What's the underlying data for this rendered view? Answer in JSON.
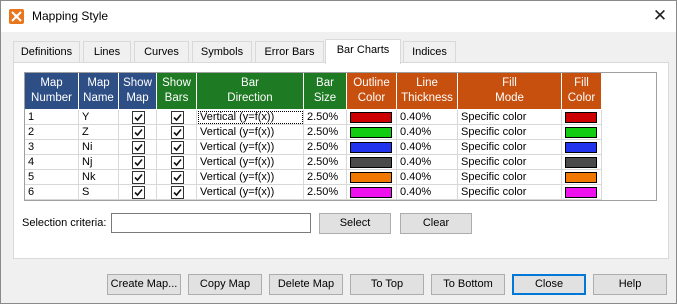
{
  "window": {
    "title": "Mapping Style",
    "close_glyph": "✕"
  },
  "tabs": [
    {
      "label": "Definitions"
    },
    {
      "label": "Lines"
    },
    {
      "label": "Curves"
    },
    {
      "label": "Symbols"
    },
    {
      "label": "Error Bars"
    },
    {
      "label": "Bar Charts"
    },
    {
      "label": "Indices"
    }
  ],
  "active_tab": "Bar Charts",
  "grid": {
    "headers": [
      {
        "line1": "Map",
        "line2": "Number"
      },
      {
        "line1": "Map",
        "line2": "Name"
      },
      {
        "line1": "Show",
        "line2": "Map"
      },
      {
        "line1": "Show",
        "line2": "Bars"
      },
      {
        "line1": "Bar",
        "line2": "Direction"
      },
      {
        "line1": "Bar",
        "line2": "Size"
      },
      {
        "line1": "Outline",
        "line2": "Color"
      },
      {
        "line1": "Line",
        "line2": "Thickness"
      },
      {
        "line1": "Fill",
        "line2": "Mode"
      },
      {
        "line1": "Fill",
        "line2": "Color"
      }
    ],
    "header_colors": {
      "blue": "#2e4f86",
      "green": "#1f7a24",
      "orange": "#c8500e"
    },
    "rows": [
      {
        "number": "1",
        "name": "Y",
        "show_map": true,
        "show_bars": true,
        "direction": "Vertical (y=f(x))",
        "size": "2.50%",
        "outline_color": "#cc0000",
        "thickness": "0.40%",
        "fill_mode": "Specific color",
        "fill_color": "#cc0000"
      },
      {
        "number": "2",
        "name": "Z",
        "show_map": true,
        "show_bars": true,
        "direction": "Vertical (y=f(x))",
        "size": "2.50%",
        "outline_color": "#11cc11",
        "thickness": "0.40%",
        "fill_mode": "Specific color",
        "fill_color": "#11cc11"
      },
      {
        "number": "3",
        "name": "Ni",
        "show_map": true,
        "show_bars": true,
        "direction": "Vertical (y=f(x))",
        "size": "2.50%",
        "outline_color": "#2233ee",
        "thickness": "0.40%",
        "fill_mode": "Specific color",
        "fill_color": "#2233ee"
      },
      {
        "number": "4",
        "name": "Nj",
        "show_map": true,
        "show_bars": true,
        "direction": "Vertical (y=f(x))",
        "size": "2.50%",
        "outline_color": "#4a4a4a",
        "thickness": "0.40%",
        "fill_mode": "Specific color",
        "fill_color": "#4a4a4a"
      },
      {
        "number": "5",
        "name": "Nk",
        "show_map": true,
        "show_bars": true,
        "direction": "Vertical (y=f(x))",
        "size": "2.50%",
        "outline_color": "#f07800",
        "thickness": "0.40%",
        "fill_mode": "Specific color",
        "fill_color": "#f07800"
      },
      {
        "number": "6",
        "name": "S",
        "show_map": true,
        "show_bars": true,
        "direction": "Vertical (y=f(x))",
        "size": "2.50%",
        "outline_color": "#ee11ee",
        "thickness": "0.40%",
        "fill_mode": "Specific color",
        "fill_color": "#ee11ee"
      }
    ]
  },
  "selection": {
    "label": "Selection criteria:",
    "value": "",
    "select_label": "Select",
    "clear_label": "Clear"
  },
  "footer_buttons": [
    {
      "label": "Create Map..."
    },
    {
      "label": "Copy Map"
    },
    {
      "label": "Delete Map"
    },
    {
      "label": "To Top"
    },
    {
      "label": "To Bottom"
    },
    {
      "label": "Close"
    },
    {
      "label": "Help"
    }
  ]
}
